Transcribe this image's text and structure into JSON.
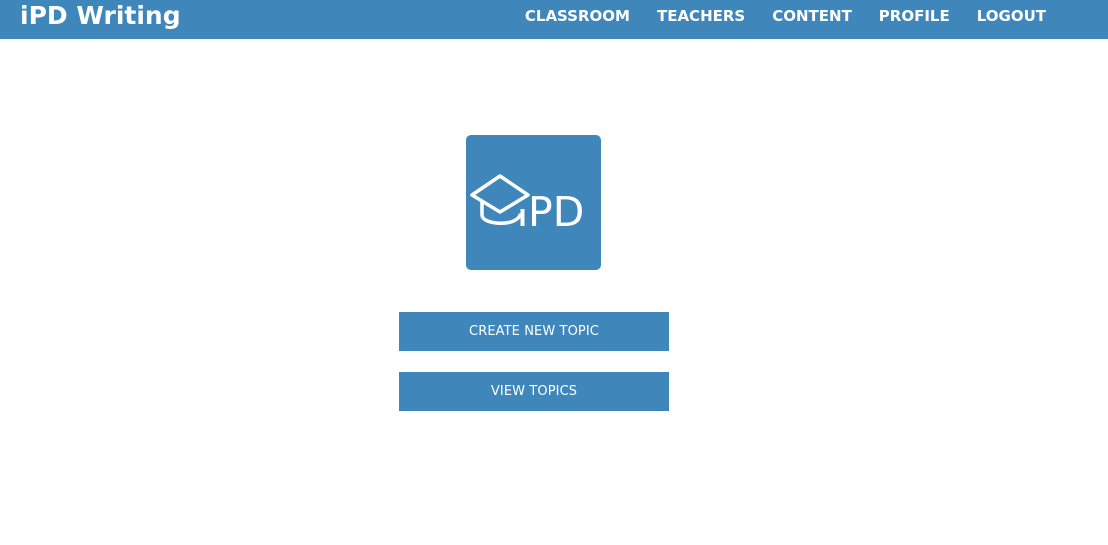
{
  "header": {
    "brand": "iPD Writing",
    "nav": [
      {
        "label": "CLASSROOM"
      },
      {
        "label": "TEACHERS"
      },
      {
        "label": "CONTENT"
      },
      {
        "label": "PROFILE"
      },
      {
        "label": "LOGOUT"
      }
    ]
  },
  "logo": {
    "text": "PD",
    "icon": "graduation-cap-icon"
  },
  "actions": {
    "create_label": "CREATE NEW TOPIC",
    "view_label": "VIEW TOPICS"
  },
  "colors": {
    "brand_blue": "#3f87bb",
    "text_on_brand": "#ffffff",
    "background": "#ffffff"
  }
}
